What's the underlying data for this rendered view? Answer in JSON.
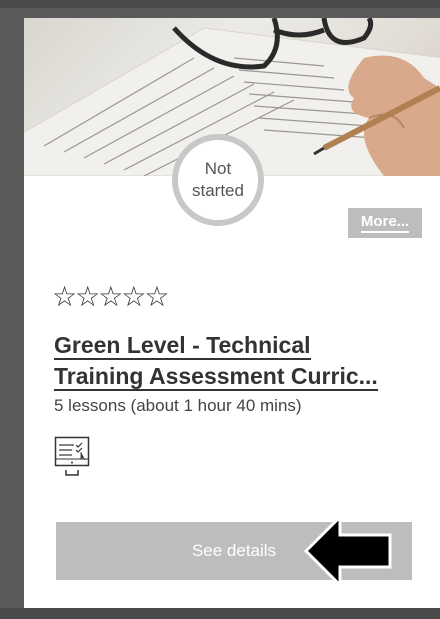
{
  "course": {
    "status": "Not started",
    "more_label": "More...",
    "rating_stars": "☆☆☆☆☆",
    "rating_value": 0,
    "rating_max": 5,
    "title": "Green Level - Technical Training Assessment Curric...",
    "lessons": "5 lessons (about 1 hour 40 mins)",
    "details_label": "See details",
    "course_type_icon": "online-assessment-icon",
    "hero_image": "exam-sheet-glasses-pencil-photo"
  },
  "colors": {
    "card_bg": "#ffffff",
    "frame_bg": "#5a5a5a",
    "button_bg": "#bdbdbd",
    "status_ring": "#c8c8c8",
    "text": "#333333"
  }
}
